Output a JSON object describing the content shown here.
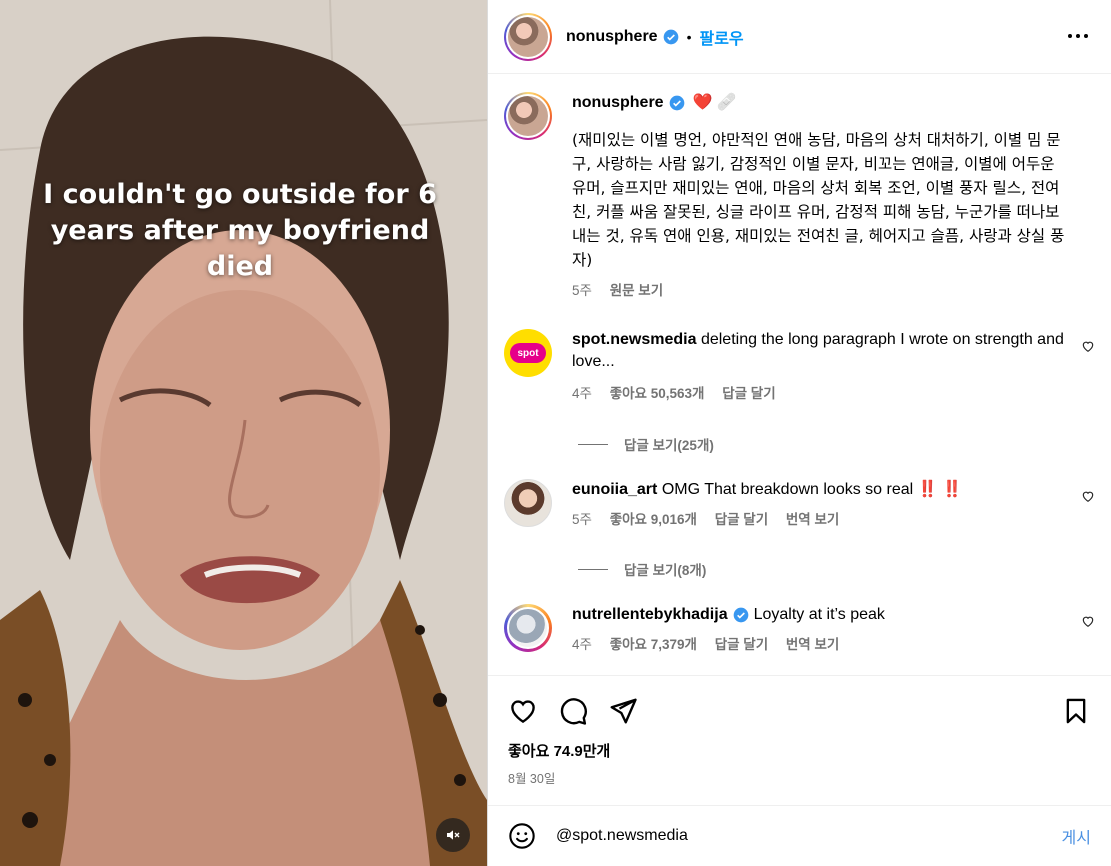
{
  "media": {
    "overlay_text": "I couldn't go outside for 6 years after my boyfriend died",
    "mute_icon": "speaker-muted-icon"
  },
  "header": {
    "username": "nonusphere",
    "separator": "•",
    "follow_label": "팔로우",
    "more_icon": "more-options-icon"
  },
  "caption": {
    "username": "nonusphere",
    "emojis": "❤️ 🩹",
    "text": "(재미있는 이별 명언, 야만적인 연애 농담, 마음의 상처 대처하기, 이별 밈 문구, 사랑하는 사람 잃기, 감정적인 이별 문자, 비꼬는 연애글, 이별에 어두운 유머, 슬프지만 재미있는 연애, 마음의 상처 회복 조언, 이별 풍자 릴스, 전여친, 커플 싸움 잘못된, 싱글 라이프 유머, 감정적 피해 농담, 누군가를 떠나보내는 것, 유독 연애 인용, 재미있는 전여친 글, 헤어지고 슬픔, 사랑과 상실 풍자)",
    "time": "5주",
    "see_original": "원문 보기"
  },
  "comments": [
    {
      "username": "spot.newsmedia",
      "text": "deleting the long paragraph I wrote on strength and love...",
      "time": "4주",
      "likes": "좋아요 50,563개",
      "reply": "답글 달기",
      "translate": "",
      "view_replies": "답글 보기(25개)"
    },
    {
      "username": "eunoiia_art",
      "text": "OMG That breakdown looks so real ‼️ ‼️",
      "time": "5주",
      "likes": "좋아요 9,016개",
      "reply": "답글 달기",
      "translate": "번역 보기",
      "view_replies": "답글 보기(8개)"
    },
    {
      "username": "nutrellentebykhadija",
      "text": "Loyalty at it’s peak",
      "time": "4주",
      "likes": "좋아요 7,379개",
      "reply": "답글 달기",
      "translate": "번역 보기",
      "view_replies": ""
    }
  ],
  "footer": {
    "likes": "좋아요 74.9만개",
    "date": "8월 30일",
    "comment_value": "@spot.newsmedia",
    "post_label": "게시"
  },
  "colors": {
    "follow": "#0095f6",
    "verified": "#3897f0",
    "meta": "#737373"
  }
}
